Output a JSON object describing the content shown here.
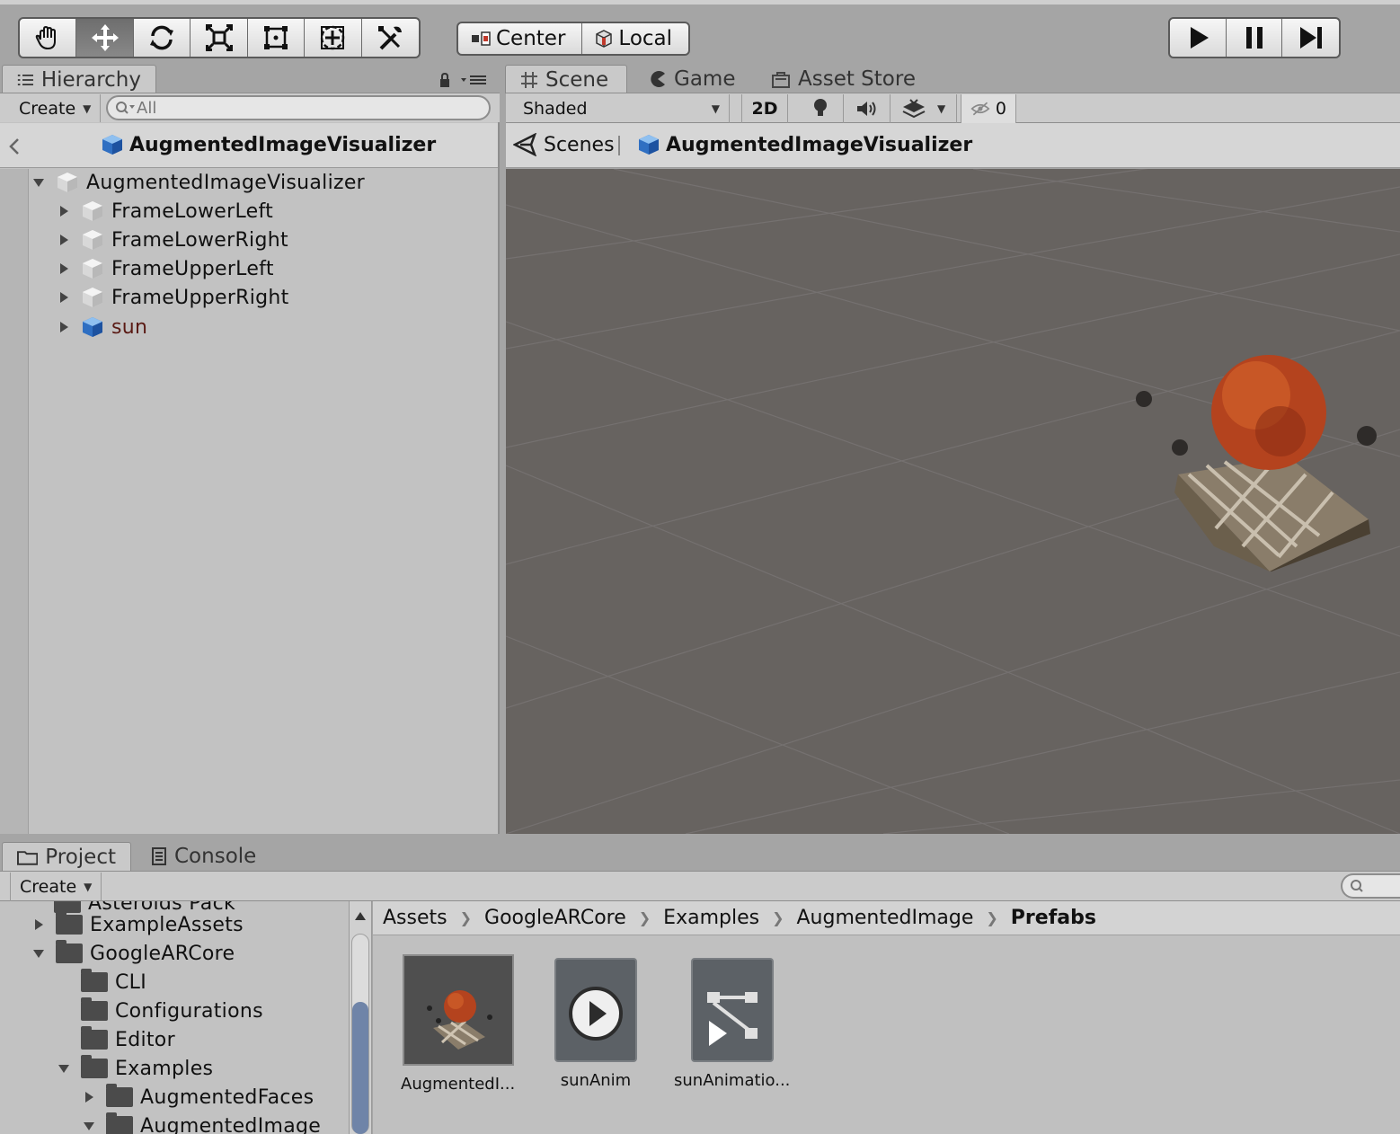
{
  "toolbar": {
    "tools": [
      "hand-tool",
      "move-tool",
      "rotate-tool",
      "scale-tool",
      "rect-tool",
      "transform-tool",
      "custom-tool"
    ],
    "pivot_label": "Center",
    "space_label": "Local"
  },
  "hierarchy": {
    "tab_label": "Hierarchy",
    "create_label": "Create",
    "search_placeholder": "All",
    "prefab_title": "AugmentedImageVisualizer",
    "root": "AugmentedImageVisualizer",
    "children": [
      "FrameLowerLeft",
      "FrameLowerRight",
      "FrameUpperLeft",
      "FrameUpperRight",
      "sun"
    ]
  },
  "scene": {
    "tabs": [
      "Scene",
      "Game",
      "Asset Store"
    ],
    "shading_mode": "Shaded",
    "mode_2d": "2D",
    "hidden_count": "0",
    "breadcrumb_root": "Scenes",
    "breadcrumb_prefab": "AugmentedImageVisualizer"
  },
  "project": {
    "tabs": [
      "Project",
      "Console"
    ],
    "create_label": "Create",
    "tree": [
      {
        "label": "Asteroids Pack",
        "depth": 1,
        "expanded": null
      },
      {
        "label": "ExampleAssets",
        "depth": 1,
        "expanded": false
      },
      {
        "label": "GoogleARCore",
        "depth": 1,
        "expanded": true
      },
      {
        "label": "CLI",
        "depth": 2,
        "expanded": null
      },
      {
        "label": "Configurations",
        "depth": 2,
        "expanded": null
      },
      {
        "label": "Editor",
        "depth": 2,
        "expanded": null
      },
      {
        "label": "Examples",
        "depth": 2,
        "expanded": true
      },
      {
        "label": "AugmentedFaces",
        "depth": 3,
        "expanded": false
      },
      {
        "label": "AugmentedImage",
        "depth": 3,
        "expanded": true
      }
    ],
    "breadcrumb": [
      "Assets",
      "GoogleARCore",
      "Examples",
      "AugmentedImage",
      "Prefabs"
    ],
    "assets": [
      {
        "label": "AugmentedI...",
        "icon": "prefab-thumbnail"
      },
      {
        "label": "sunAnim",
        "icon": "animation-clip-icon"
      },
      {
        "label": "sunAnimatio...",
        "icon": "animator-controller-icon"
      }
    ]
  },
  "colors": {
    "background": "#a5a5a5",
    "panel": "#c2c2c2",
    "scene_background": "#676360",
    "prefab_text": "#5a1a14"
  }
}
